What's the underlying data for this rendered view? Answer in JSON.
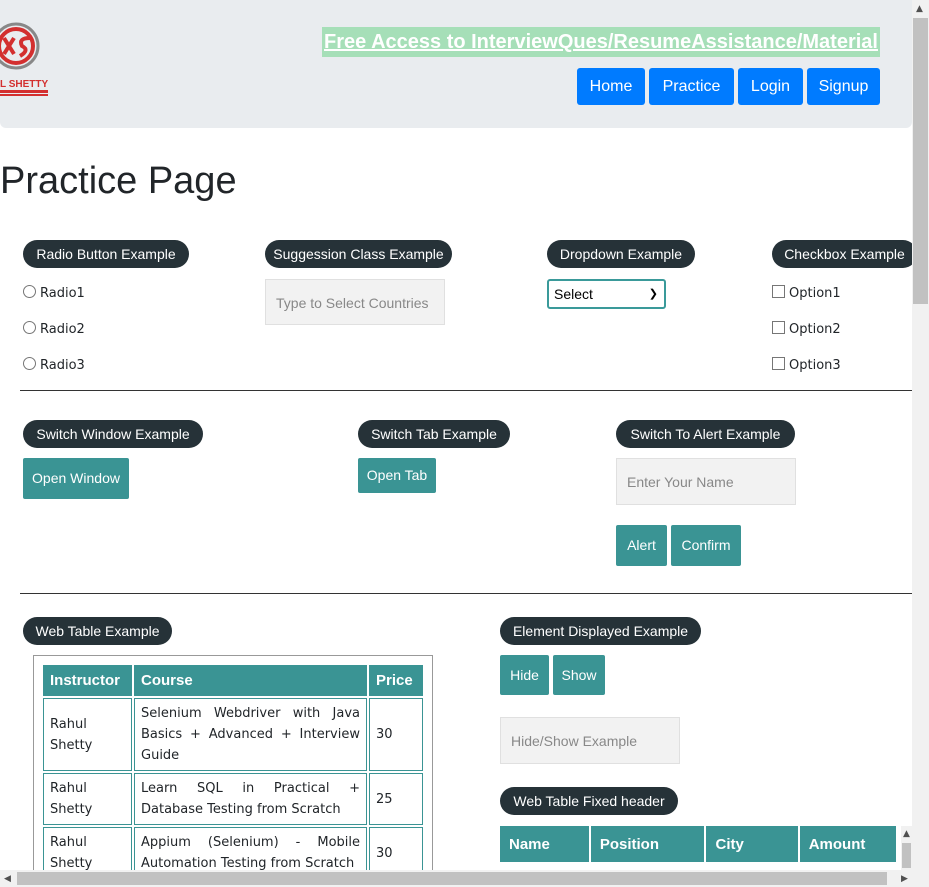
{
  "header": {
    "logo_text": "RAHUL SHETTY",
    "promo_link": "Free Access to InterviewQues/ResumeAssistance/Material",
    "nav": [
      "Home",
      "Practice",
      "Login",
      "Signup"
    ]
  },
  "page_title": "Practice Page",
  "radio": {
    "legend": "Radio Button Example",
    "options": [
      "Radio1",
      "Radio2",
      "Radio3"
    ]
  },
  "suggestion": {
    "legend": "Suggession Class Example",
    "placeholder": "Type to Select Countries"
  },
  "dropdown": {
    "legend": "Dropdown Example",
    "selected": "Select"
  },
  "checkbox": {
    "legend": "Checkbox Example",
    "options": [
      "Option1",
      "Option2",
      "Option3"
    ]
  },
  "switch_window": {
    "legend": "Switch Window Example",
    "button": "Open Window"
  },
  "switch_tab": {
    "legend": "Switch Tab Example",
    "button": "Open Tab"
  },
  "alert": {
    "legend": "Switch To Alert Example",
    "placeholder": "Enter Your Name",
    "alert_button": "Alert",
    "confirm_button": "Confirm"
  },
  "web_table": {
    "legend": "Web Table Example",
    "headers": [
      "Instructor",
      "Course",
      "Price"
    ],
    "rows": [
      [
        "Rahul Shetty",
        "Selenium Webdriver with Java Basics + Advanced + Interview Guide",
        "30"
      ],
      [
        "Rahul Shetty",
        "Learn SQL in Practical + Database Testing from Scratch",
        "25"
      ],
      [
        "Rahul Shetty",
        "Appium (Selenium) - Mobile Automation Testing from Scratch",
        "30"
      ]
    ]
  },
  "element_displayed": {
    "legend": "Element Displayed Example",
    "hide_button": "Hide",
    "show_button": "Show",
    "placeholder": "Hide/Show Example"
  },
  "fixed_header": {
    "legend": "Web Table Fixed header",
    "headers": [
      "Name",
      "Position",
      "City",
      "Amount"
    ]
  },
  "colors": {
    "header_bg": "#e9ecef",
    "nav_button": "#007bff",
    "promo_bg": "#a6dfb8",
    "legend_bg": "#263238",
    "teal": "#3a9494"
  }
}
